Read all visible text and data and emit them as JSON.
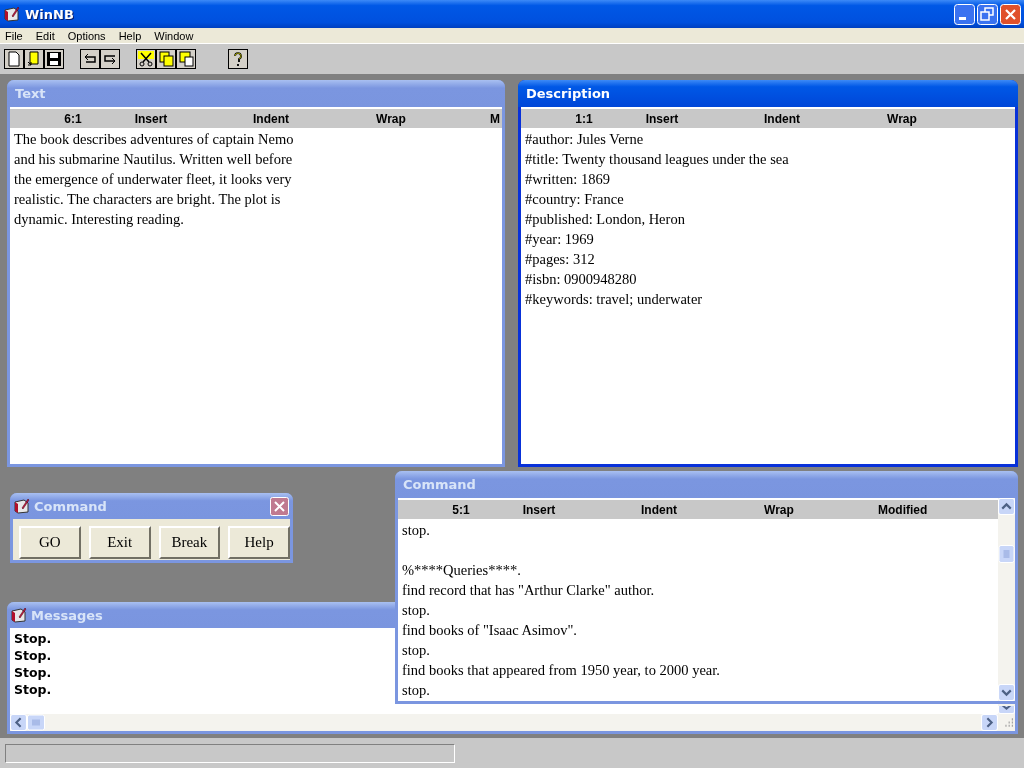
{
  "app": {
    "title": "WinNB"
  },
  "menu": [
    {
      "label": "File"
    },
    {
      "label": "Edit"
    },
    {
      "label": "Options"
    },
    {
      "label": "Help"
    },
    {
      "label": "Window"
    }
  ],
  "text_window": {
    "title": "Text",
    "active": false,
    "status": [
      "6:1",
      "Insert",
      "Indent",
      "Wrap",
      "M"
    ],
    "lines": [
      "The book describes adventures of captain Nemo",
      "and his submarine Nautilus. Written well before",
      "the emergence of underwater fleet, it looks very",
      "realistic. The characters are bright. The plot is",
      "dynamic. Interesting reading."
    ]
  },
  "description_window": {
    "title": "Description",
    "active": true,
    "status": [
      "1:1",
      "Insert",
      "Indent",
      "Wrap"
    ],
    "lines": [
      "#author: Jules Verne",
      "#title: Twenty thousand leagues under the sea",
      "#written: 1869",
      "#country: France",
      "#published: London, Heron",
      "#year: 1969",
      "#pages: 312",
      "#isbn: 0900948280",
      "#keywords: travel; underwater"
    ]
  },
  "command_dialog": {
    "title": "Command",
    "active": false,
    "buttons": [
      "GO",
      "Exit",
      "Break",
      "Help"
    ]
  },
  "messages_window": {
    "title": "Messages",
    "active": false,
    "lines": [
      "Stop.",
      "Stop.",
      "Stop.",
      "Stop."
    ]
  },
  "command_window": {
    "title": "Command",
    "active": false,
    "status": [
      "5:1",
      "Insert",
      "Indent",
      "Wrap",
      "Modified"
    ],
    "paragraphs": [
      [
        "stop."
      ],
      [
        "%****Queries****.",
        "find record that has \"Arthur Clarke\" author.",
        "stop.",
        "find books of \"Isaac Asimov\".",
        "stop.",
        "find books that appeared from 1950 year, to 2000 year.",
        "stop."
      ]
    ]
  }
}
